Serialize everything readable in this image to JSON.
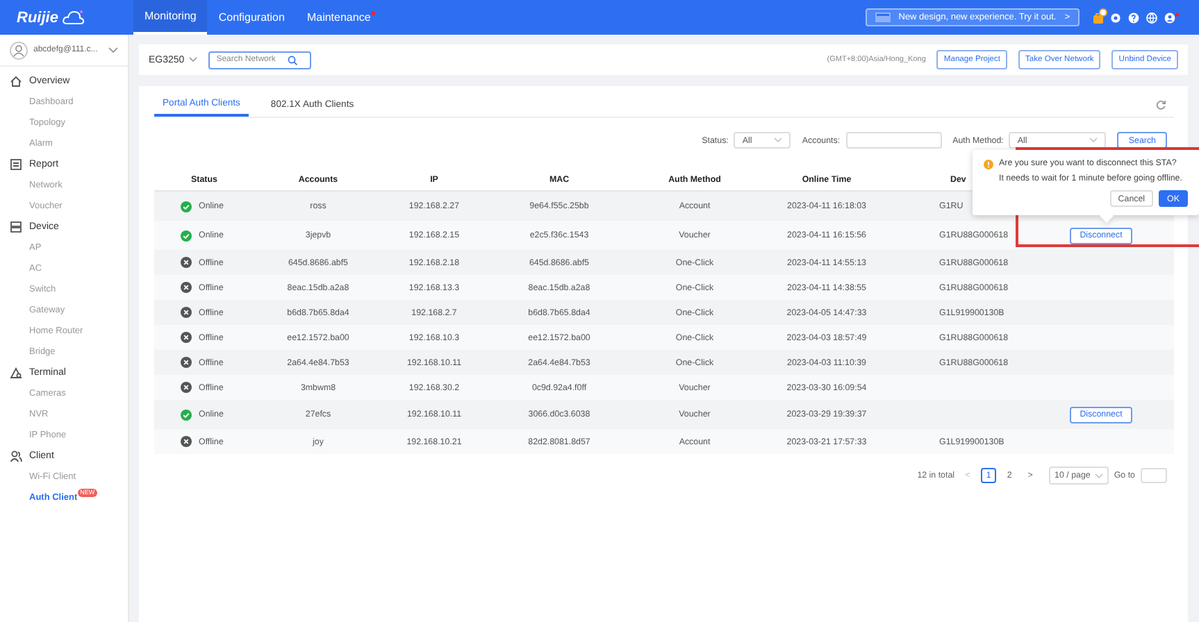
{
  "header": {
    "logo": "Ruijie",
    "nav": [
      {
        "label": "Monitoring",
        "selected": true,
        "alert": false
      },
      {
        "label": "Configuration",
        "selected": false,
        "alert": false
      },
      {
        "label": "Maintenance",
        "selected": false,
        "alert": true
      }
    ],
    "promo": "New design, new experience. Try it out.",
    "promo_arrow": ">"
  },
  "sidebar": {
    "user": "abcdefg@111.c...",
    "sections": [
      {
        "label": "Overview",
        "items": [
          {
            "label": "Dashboard",
            "selected": false
          },
          {
            "label": "Topology",
            "selected": false
          },
          {
            "label": "Alarm",
            "selected": false
          }
        ]
      },
      {
        "label": "Report",
        "items": [
          {
            "label": "Network",
            "selected": false
          },
          {
            "label": "Voucher",
            "selected": false
          }
        ]
      },
      {
        "label": "Device",
        "items": [
          {
            "label": "AP",
            "selected": false
          },
          {
            "label": "AC",
            "selected": false
          },
          {
            "label": "Switch",
            "selected": false
          },
          {
            "label": "Gateway",
            "selected": false
          },
          {
            "label": "Home Router",
            "selected": false
          },
          {
            "label": "Bridge",
            "selected": false
          }
        ]
      },
      {
        "label": "Terminal",
        "items": [
          {
            "label": "Cameras",
            "selected": false
          },
          {
            "label": "NVR",
            "selected": false
          },
          {
            "label": "IP Phone",
            "selected": false
          }
        ]
      },
      {
        "label": "Client",
        "items": [
          {
            "label": "Wi-Fi Client",
            "selected": false
          },
          {
            "label": "Auth Client",
            "selected": true,
            "badge": "NEW"
          }
        ]
      }
    ]
  },
  "toolbar": {
    "device": "EG3250",
    "search_placeholder": "Search Network",
    "timezone": "(GMT+8:00)Asia/Hong_Kong",
    "buttons": [
      "Manage Project",
      "Take Over Network",
      "Unbind Device"
    ]
  },
  "tabs": [
    {
      "label": "Portal Auth Clients",
      "selected": true
    },
    {
      "label": "802.1X Auth Clients",
      "selected": false
    }
  ],
  "filters": [
    {
      "label": "Status:",
      "kind": "select",
      "value": "All"
    },
    {
      "label": "Accounts:",
      "kind": "input"
    },
    {
      "label": "Auth Method:",
      "kind": "select",
      "value": "All"
    }
  ],
  "search_button": "Search",
  "table": {
    "columns": [
      "Status",
      "Accounts",
      "IP",
      "MAC",
      "Auth Method",
      "Online Time",
      "Dev"
    ],
    "rows": [
      {
        "status": "Online",
        "online": true,
        "account": "ross",
        "ip": "192.168.2.27",
        "mac": "9e64.f55c.25bb",
        "auth": "Account",
        "time": "2023-04-11 16:18:03",
        "device": "G1RU"
      },
      {
        "status": "Online",
        "online": true,
        "account": "3jepvb",
        "ip": "192.168.2.15",
        "mac": "e2c5.f36c.1543",
        "auth": "Voucher",
        "time": "2023-04-11 16:15:56",
        "device": "G1RU88G000618",
        "action": "Disconnect"
      },
      {
        "status": "Offline",
        "online": false,
        "account": "645d.8686.abf5",
        "ip": "192.168.2.18",
        "mac": "645d.8686.abf5",
        "auth": "One-Click",
        "time": "2023-04-11 14:55:13",
        "device": "G1RU88G000618"
      },
      {
        "status": "Offline",
        "online": false,
        "account": "8eac.15db.a2a8",
        "ip": "192.168.13.3",
        "mac": "8eac.15db.a2a8",
        "auth": "One-Click",
        "time": "2023-04-11 14:38:55",
        "device": "G1RU88G000618"
      },
      {
        "status": "Offline",
        "online": false,
        "account": "b6d8.7b65.8da4",
        "ip": "192.168.2.7",
        "mac": "b6d8.7b65.8da4",
        "auth": "One-Click",
        "time": "2023-04-05 14:47:33",
        "device": "G1L919900130B"
      },
      {
        "status": "Offline",
        "online": false,
        "account": "ee12.1572.ba00",
        "ip": "192.168.10.3",
        "mac": "ee12.1572.ba00",
        "auth": "One-Click",
        "time": "2023-04-03 18:57:49",
        "device": "G1RU88G000618"
      },
      {
        "status": "Offline",
        "online": false,
        "account": "2a64.4e84.7b53",
        "ip": "192.168.10.11",
        "mac": "2a64.4e84.7b53",
        "auth": "One-Click",
        "time": "2023-04-03 11:10:39",
        "device": "G1RU88G000618"
      },
      {
        "status": "Offline",
        "online": false,
        "account": "3mbwm8",
        "ip": "192.168.30.2",
        "mac": "0c9d.92a4.f0ff",
        "auth": "Voucher",
        "time": "2023-03-30 16:09:54"
      },
      {
        "status": "Online",
        "online": true,
        "account": "27efcs",
        "ip": "192.168.10.11",
        "mac": "3066.d0c3.6038",
        "auth": "Voucher",
        "time": "2023-03-29 19:39:37",
        "action": "Disconnect"
      },
      {
        "status": "Offline",
        "online": false,
        "account": "joy",
        "ip": "192.168.10.21",
        "mac": "82d2.8081.8d57",
        "auth": "Account",
        "time": "2023-03-21 17:57:33",
        "device": "G1L919900130B"
      }
    ]
  },
  "pagination": {
    "total": "12 in total",
    "prev": "<",
    "pages": [
      {
        "label": "1",
        "selected": true
      },
      {
        "label": "2",
        "selected": false
      }
    ],
    "next": ">",
    "page_size": "10 / page",
    "goto": "Go to"
  },
  "popover": {
    "message": "Are you sure you want to disconnect this STA?",
    "detail": "It needs to wait for 1 minute before going offline.",
    "buttons": [
      {
        "label": "Cancel",
        "kind": "secondary"
      },
      {
        "label": "OK",
        "kind": "primary"
      }
    ]
  }
}
